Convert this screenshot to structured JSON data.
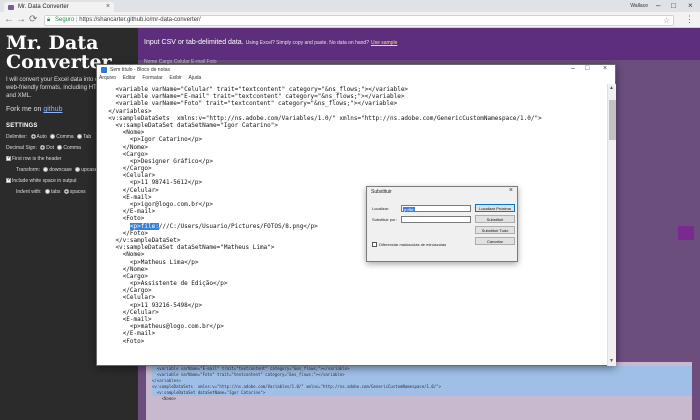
{
  "browser": {
    "tab_title": "Mr. Data Converter",
    "tab_close": "×",
    "user_name": "Wallace",
    "win_min": "–",
    "win_max": "□",
    "win_close": "×",
    "back": "←",
    "forward": "→",
    "reload": "⟳",
    "secure_label": "Seguro",
    "url": "https://shancarter.github.io/mr-data-converter/",
    "star": "☆",
    "menu": "⋮"
  },
  "sidebar": {
    "title": "Mr. Data Converter",
    "intro": "I will convert your Excel data into one of several web-friendly formats, including HTML, JSON and XML.",
    "fork_prefix": "Fork me on",
    "fork_link": "github",
    "settings_heading": "SETTINGS",
    "delimiter_label": "Delimiter:",
    "delimiter_options": [
      "Auto",
      "Comma",
      "Tab"
    ],
    "decimal_label": "Decimal Sign:",
    "decimal_options": [
      "Dot",
      "Comma"
    ],
    "first_row_header": "First row is the header",
    "transform_label": "Transform:",
    "transform_options": [
      "downcase",
      "upcase"
    ],
    "include_whitespace": "Include white space in output",
    "indent_label": "Indent with:",
    "indent_options": [
      "tabs",
      "spaces"
    ]
  },
  "main": {
    "input_title": "Input CSV or tab-delimited data.",
    "input_sub": "Using Excel? Simply copy and paste. No data on hand?",
    "sample_link": "Use sample",
    "header_row": "Nome       Cargo       Celular  E-mail     Foto"
  },
  "notepad": {
    "title": "Sem título - Bloco de notas",
    "menus": [
      "Arquivo",
      "Editar",
      "Formatar",
      "Exibir",
      "Ajuda"
    ],
    "lines": [
      "    <variable varName=\"Celular\" trait=\"textcontent\" category=\"&ns_flows;\"></variable>",
      "    <variable varName=\"E-mail\" trait=\"textcontent\" category=\"&ns_flows;\"></variable>",
      "    <variable varName=\"Foto\" trait=\"textcontent\" category=\"&ns_flows;\"></variable>",
      "  </variables>",
      "  <v:sampleDataSets  xmlns:v=\"http://ns.adobe.com/Variables/1.0/\" xmlns=\"http://ns.adobe.com/GenericCustomNamespace/1.0/\">",
      "    <v:sampleDataSet dataSetName=\"Igor Catarino\">",
      "      <Nome>",
      "        <p>Igor Catarino</p>",
      "      </Nome>",
      "      <Cargo>",
      "        <p>Designer Gráfico</p>",
      "      </Cargo>",
      "      <Celular>",
      "        <p>11 98741-5612</p>",
      "      </Celular>",
      "      <E-mail>",
      "        <p>igor@logo.com.br</p>",
      "      </E-mail>",
      "      <Foto>",
      "        <p>file:///C:/Users/Usuario/Pictures/FOTOS/8.png</p>",
      "      </Foto>",
      "    </v:sampleDataSet>",
      "    <v:sampleDataSet dataSetName=\"Matheus Lima\">",
      "      <Nome>",
      "        <p>Matheus Lima</p>",
      "      </Nome>",
      "      <Cargo>",
      "        <p>Assistente de Edição</p>",
      "      </Cargo>",
      "      <Celular>",
      "        <p>11 93216-5498</p>",
      "      </Celular>",
      "      <E-mail>",
      "        <p>matheus@logo.com.br</p>",
      "      </E-mail>",
      "      <Foto>"
    ],
    "selected_text": "<p>file:"
  },
  "dialog": {
    "title": "Substituir",
    "close": "×",
    "find_label": "Localizar:",
    "find_value": "p>file",
    "replace_label": "Substituir por:",
    "replace_value": "",
    "btn_find_next": "Localizar Próxima",
    "btn_replace": "Substituir",
    "btn_replace_all": "Substituir Tudo",
    "btn_cancel": "Cancelar",
    "match_case": "Diferenciar maiúsculas de minúsculas"
  },
  "output": {
    "lines": [
      "  <variable varName=\"E-mail\" trait=\"textcontent\" category=\"&ns_flows;\"></variable>",
      "  <variable varName=\"Foto\" trait=\"textcontent\" category=\"&ns_flows;\"></variable>",
      "</variables>",
      "<v:sampleDataSets  xmlns:v=\"http://ns.adobe.com/Variables/1.0/\" xmlns=\"http://ns.adobe.com/GenericCustomNamespace/1.0/\">",
      "  <v:sampleDataSet dataSetName=\"Igor Catarino\">",
      "    <Nome>"
    ]
  },
  "colors": {
    "header_purple": "#5d2e7c",
    "sidebar_bg": "#2b2b2b",
    "selection_blue": "#3c7fd9"
  }
}
